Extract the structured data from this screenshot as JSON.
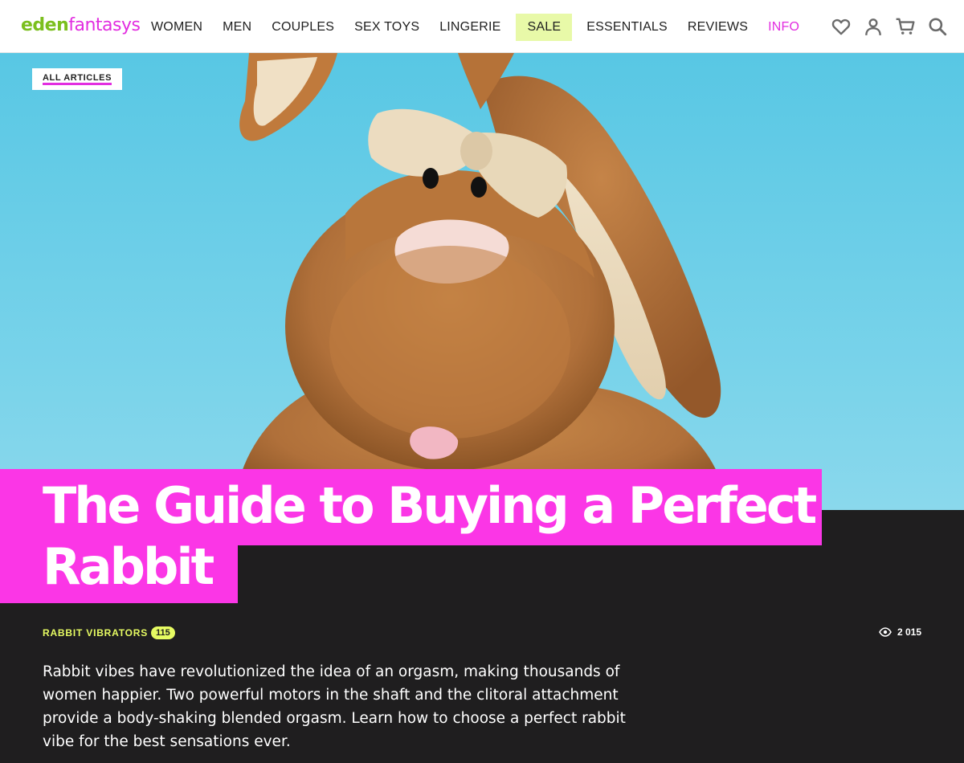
{
  "header": {
    "logo": {
      "part1": "eden",
      "part2": "fantasys"
    },
    "nav": [
      {
        "label": "WOMEN"
      },
      {
        "label": "MEN"
      },
      {
        "label": "COUPLES"
      },
      {
        "label": "SEX TOYS"
      },
      {
        "label": "LINGERIE"
      },
      {
        "label": "SALE"
      },
      {
        "label": "ESSENTIALS"
      },
      {
        "label": "REVIEWS"
      },
      {
        "label": "INFO"
      }
    ],
    "icons": [
      "heart-icon",
      "user-icon",
      "cart-icon",
      "search-icon"
    ]
  },
  "hero": {
    "back_link": "ALL ARTICLES",
    "image": "plush-bunny-photo"
  },
  "article": {
    "title": "The Guide to Buying a Perfect Rabbit",
    "category": "RABBIT VIBRATORS",
    "category_count": "115",
    "views": "2 015",
    "intro": "Rabbit vibes have revolutionized the idea of an orgasm, making thousands of women happier. Two powerful motors in the shaft and the clitoral attachment provide a body-shaking blended orgasm. Learn how to choose a perfect rabbit vibe for the best sensations ever."
  },
  "colors": {
    "brand_green": "#7bbf1e",
    "brand_pink": "#e22ee0",
    "title_bg": "#fb36e6",
    "accent_yellow": "#e6fb62",
    "sale_bg": "#e8f9a8",
    "dark_bg": "#1f1e1f"
  }
}
